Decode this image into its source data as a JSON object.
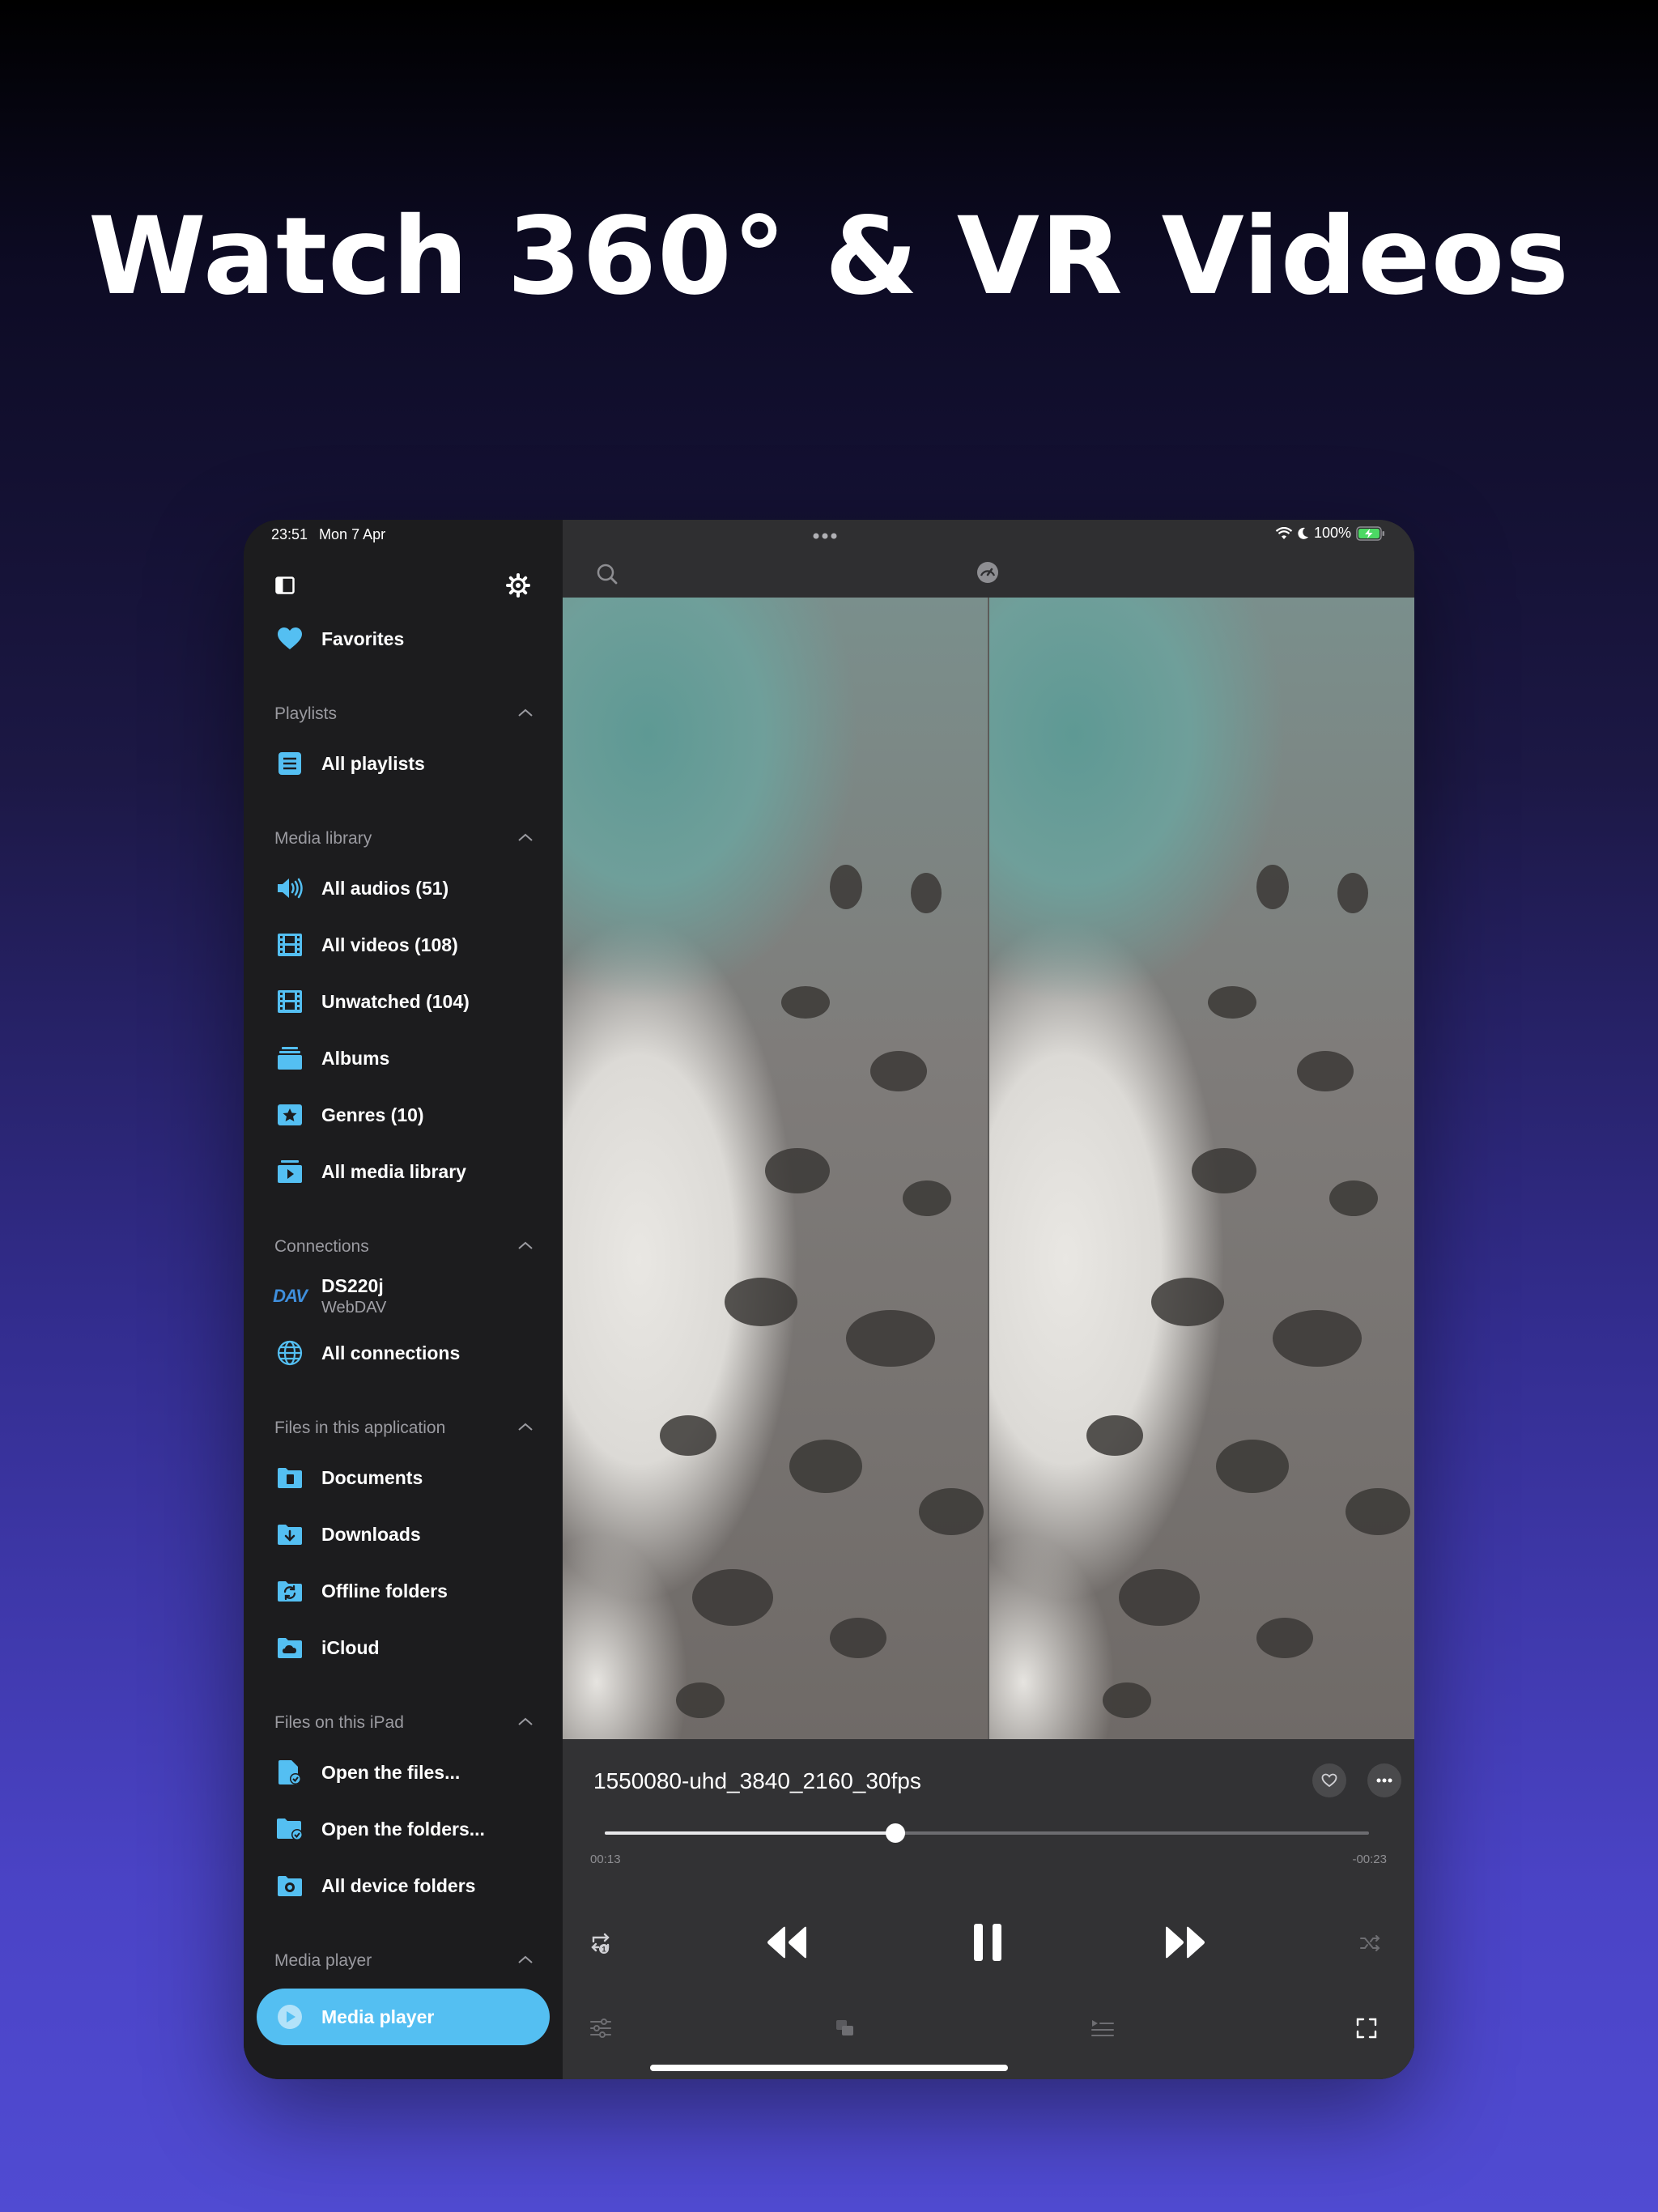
{
  "headline": "Watch 360° & VR Videos",
  "status": {
    "time": "23:51",
    "date": "Mon 7 Apr",
    "battery": "100%"
  },
  "sidebar": {
    "favorites": "Favorites",
    "sections": {
      "playlists": "Playlists",
      "media_library": "Media library",
      "connections": "Connections",
      "files_app": "Files in this application",
      "files_ipad": "Files on this iPad",
      "media_player": "Media player"
    },
    "items": {
      "all_playlists": "All playlists",
      "all_audios": "All audios (51)",
      "all_videos": "All videos (108)",
      "unwatched": "Unwatched (104)",
      "albums": "Albums",
      "genres": "Genres (10)",
      "all_media_library": "All media library",
      "ds220j": "DS220j",
      "ds220j_sub": "WebDAV",
      "dav_badge": "DAV",
      "all_connections": "All connections",
      "documents": "Documents",
      "downloads": "Downloads",
      "offline_folders": "Offline folders",
      "icloud": "iCloud",
      "open_files": "Open the files...",
      "open_folders": "Open the folders...",
      "all_device_folders": "All device folders",
      "media_player": "Media player"
    }
  },
  "player": {
    "title": "1550080-uhd_3840_2160_30fps",
    "elapsed": "00:13",
    "remaining": "-00:23",
    "progress": 0.38
  },
  "colors": {
    "accent": "#54bff2"
  }
}
